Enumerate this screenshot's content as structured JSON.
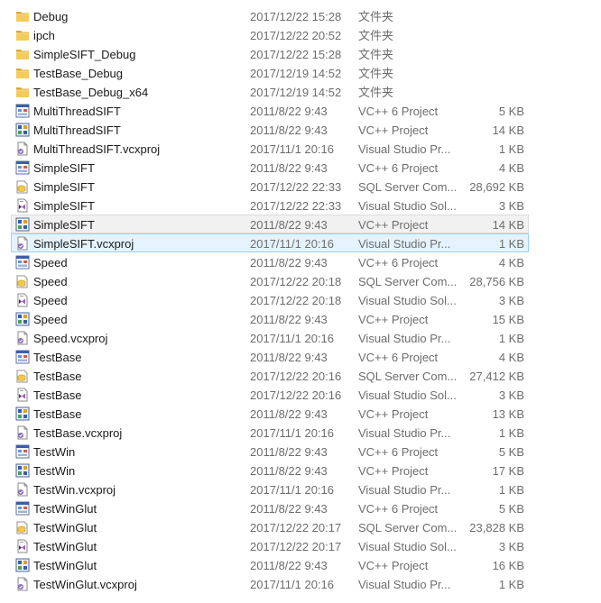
{
  "files": [
    {
      "name": "Debug",
      "date": "2017/12/22 15:28",
      "type": "文件夹",
      "size": "",
      "icon": "folder-icon"
    },
    {
      "name": "ipch",
      "date": "2017/12/22 20:52",
      "type": "文件夹",
      "size": "",
      "icon": "folder-icon"
    },
    {
      "name": "SimpleSIFT_Debug",
      "date": "2017/12/22 15:28",
      "type": "文件夹",
      "size": "",
      "icon": "folder-icon"
    },
    {
      "name": "TestBase_Debug",
      "date": "2017/12/19 14:52",
      "type": "文件夹",
      "size": "",
      "icon": "folder-icon"
    },
    {
      "name": "TestBase_Debug_x64",
      "date": "2017/12/19 14:52",
      "type": "文件夹",
      "size": "",
      "icon": "folder-icon"
    },
    {
      "name": "MultiThreadSIFT",
      "date": "2011/8/22 9:43",
      "type": "VC++ 6 Project",
      "size": "5 KB",
      "icon": "vc6-project-icon"
    },
    {
      "name": "MultiThreadSIFT",
      "date": "2011/8/22 9:43",
      "type": "VC++ Project",
      "size": "14 KB",
      "icon": "vc-project-icon"
    },
    {
      "name": "MultiThreadSIFT.vcxproj",
      "date": "2017/11/1 20:16",
      "type": "Visual Studio Pr...",
      "size": "1 KB",
      "icon": "vs-project-icon"
    },
    {
      "name": "SimpleSIFT",
      "date": "2011/8/22 9:43",
      "type": "VC++ 6 Project",
      "size": "4 KB",
      "icon": "vc6-project-icon"
    },
    {
      "name": "SimpleSIFT",
      "date": "2017/12/22 22:33",
      "type": "SQL Server Com...",
      "size": "28,692 KB",
      "icon": "sql-db-icon"
    },
    {
      "name": "SimpleSIFT",
      "date": "2017/12/22 22:33",
      "type": "Visual Studio Sol...",
      "size": "3 KB",
      "icon": "vs-solution-icon"
    },
    {
      "name": "SimpleSIFT",
      "date": "2011/8/22 9:43",
      "type": "VC++ Project",
      "size": "14 KB",
      "icon": "vc-project-icon"
    },
    {
      "name": "SimpleSIFT.vcxproj",
      "date": "2017/11/1 20:16",
      "type": "Visual Studio Pr...",
      "size": "1 KB",
      "icon": "vs-project-icon"
    },
    {
      "name": "Speed",
      "date": "2011/8/22 9:43",
      "type": "VC++ 6 Project",
      "size": "4 KB",
      "icon": "vc6-project-icon"
    },
    {
      "name": "Speed",
      "date": "2017/12/22 20:18",
      "type": "SQL Server Com...",
      "size": "28,756 KB",
      "icon": "sql-db-icon"
    },
    {
      "name": "Speed",
      "date": "2017/12/22 20:18",
      "type": "Visual Studio Sol...",
      "size": "3 KB",
      "icon": "vs-solution-icon"
    },
    {
      "name": "Speed",
      "date": "2011/8/22 9:43",
      "type": "VC++ Project",
      "size": "15 KB",
      "icon": "vc-project-icon"
    },
    {
      "name": "Speed.vcxproj",
      "date": "2017/11/1 20:16",
      "type": "Visual Studio Pr...",
      "size": "1 KB",
      "icon": "vs-project-icon"
    },
    {
      "name": "TestBase",
      "date": "2011/8/22 9:43",
      "type": "VC++ 6 Project",
      "size": "4 KB",
      "icon": "vc6-project-icon"
    },
    {
      "name": "TestBase",
      "date": "2017/12/22 20:16",
      "type": "SQL Server Com...",
      "size": "27,412 KB",
      "icon": "sql-db-icon"
    },
    {
      "name": "TestBase",
      "date": "2017/12/22 20:16",
      "type": "Visual Studio Sol...",
      "size": "3 KB",
      "icon": "vs-solution-icon"
    },
    {
      "name": "TestBase",
      "date": "2011/8/22 9:43",
      "type": "VC++ Project",
      "size": "13 KB",
      "icon": "vc-project-icon"
    },
    {
      "name": "TestBase.vcxproj",
      "date": "2017/11/1 20:16",
      "type": "Visual Studio Pr...",
      "size": "1 KB",
      "icon": "vs-project-icon"
    },
    {
      "name": "TestWin",
      "date": "2011/8/22 9:43",
      "type": "VC++ 6 Project",
      "size": "5 KB",
      "icon": "vc6-project-icon"
    },
    {
      "name": "TestWin",
      "date": "2011/8/22 9:43",
      "type": "VC++ Project",
      "size": "17 KB",
      "icon": "vc-project-icon"
    },
    {
      "name": "TestWin.vcxproj",
      "date": "2017/11/1 20:16",
      "type": "Visual Studio Pr...",
      "size": "1 KB",
      "icon": "vs-project-icon"
    },
    {
      "name": "TestWinGlut",
      "date": "2011/8/22 9:43",
      "type": "VC++ 6 Project",
      "size": "5 KB",
      "icon": "vc6-project-icon"
    },
    {
      "name": "TestWinGlut",
      "date": "2017/12/22 20:17",
      "type": "SQL Server Com...",
      "size": "23,828 KB",
      "icon": "sql-db-icon"
    },
    {
      "name": "TestWinGlut",
      "date": "2017/12/22 20:17",
      "type": "Visual Studio Sol...",
      "size": "3 KB",
      "icon": "vs-solution-icon"
    },
    {
      "name": "TestWinGlut",
      "date": "2011/8/22 9:43",
      "type": "VC++ Project",
      "size": "16 KB",
      "icon": "vc-project-icon"
    },
    {
      "name": "TestWinGlut.vcxproj",
      "date": "2017/11/1 20:16",
      "type": "Visual Studio Pr...",
      "size": "1 KB",
      "icon": "vs-project-icon"
    }
  ],
  "hover_row": 11,
  "selected_row": 12,
  "colors": {
    "folder": "#e8b83a",
    "selection": "#e5f3ff",
    "selection_border": "#99d1ff",
    "hover": "#f1f1f1"
  }
}
